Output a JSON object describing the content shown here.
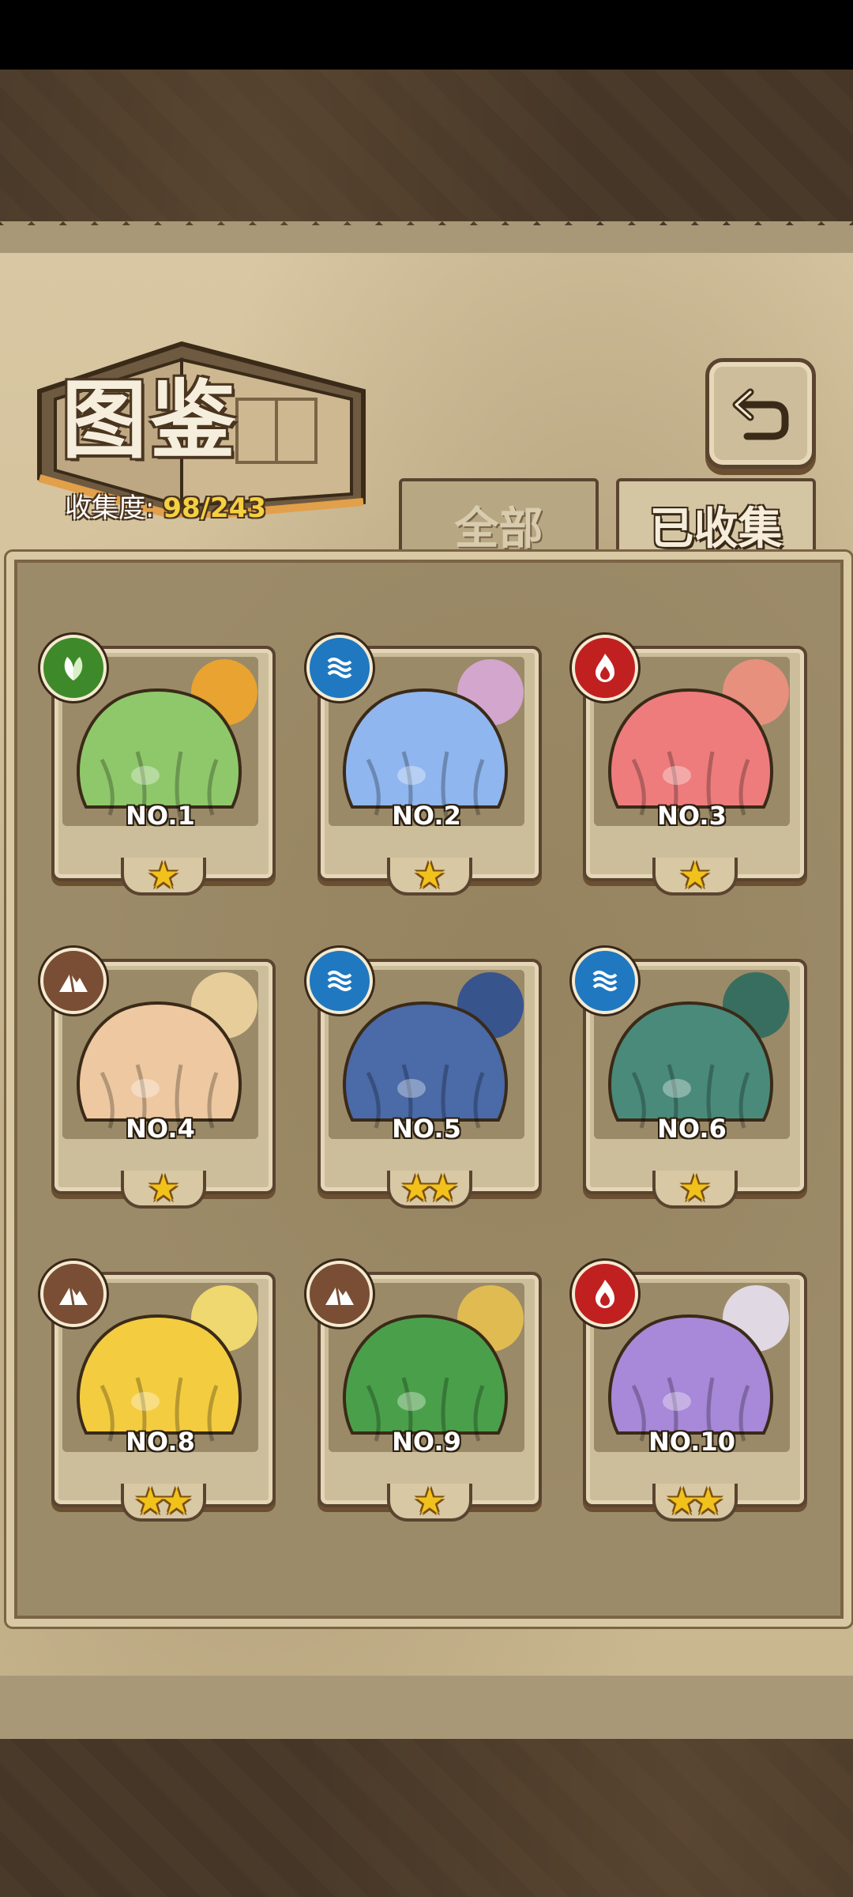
{
  "header": {
    "title": "图鉴",
    "collection_label": "收集度:",
    "collection_count": "98/243"
  },
  "tabs": [
    {
      "label": "全部",
      "selected": false
    },
    {
      "label": "已收集",
      "selected": true
    }
  ],
  "colors": {
    "grass": "#3e8a2a",
    "water": "#1f78c0",
    "fire": "#c02020",
    "earth": "#7a4e34",
    "count_highlight": "#f6d040"
  },
  "cards": [
    {
      "number": "NO.1",
      "element": "grass",
      "stars": 1,
      "art_color": "#8ec86a",
      "accent": "#f2a52a"
    },
    {
      "number": "NO.2",
      "element": "water",
      "stars": 1,
      "art_color": "#8fb6ee",
      "accent": "#d8a8d8"
    },
    {
      "number": "NO.3",
      "element": "fire",
      "stars": 1,
      "art_color": "#ee7c7c",
      "accent": "#f09080"
    },
    {
      "number": "NO.4",
      "element": "earth",
      "stars": 1,
      "art_color": "#eec8a0",
      "accent": "#f0d4a0"
    },
    {
      "number": "NO.5",
      "element": "water",
      "stars": 2,
      "art_color": "#4a6aa8",
      "accent": "#2e4e90"
    },
    {
      "number": "NO.6",
      "element": "water",
      "stars": 1,
      "art_color": "#4a8a7a",
      "accent": "#2e6a5e"
    },
    {
      "number": "NO.8",
      "element": "earth",
      "stars": 2,
      "art_color": "#f4cc40",
      "accent": "#f7e070"
    },
    {
      "number": "NO.9",
      "element": "earth",
      "stars": 1,
      "art_color": "#4aa04a",
      "accent": "#e8c050"
    },
    {
      "number": "NO.10",
      "element": "fire",
      "stars": 2,
      "art_color": "#a888d8",
      "accent": "#e8e0f0"
    }
  ]
}
